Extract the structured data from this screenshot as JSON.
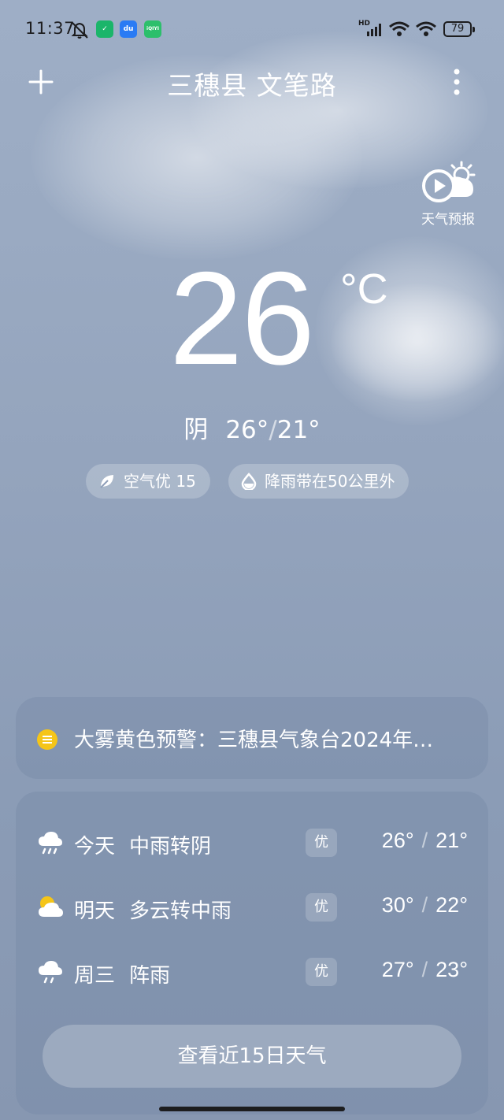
{
  "status_bar": {
    "time": "11:37",
    "network_label": "HD",
    "battery": "79",
    "apps": [
      "shield-app",
      "du",
      "iQIYI"
    ]
  },
  "header": {
    "location": "三穗县 文笔路"
  },
  "forecast_video": {
    "label": "天气预报"
  },
  "current": {
    "temperature": "26",
    "unit": "°C",
    "condition": "阴",
    "high": "26°",
    "low": "21°"
  },
  "pills": {
    "air": "空气优 15",
    "rain": "降雨带在50公里外"
  },
  "alert": {
    "text": "大雾黄色预警：三穗县气象台2024年…",
    "color": "#f5c518"
  },
  "forecast": [
    {
      "day": "今天",
      "condition": "中雨转阴",
      "aqi": "优",
      "high": "26°",
      "low": "21°",
      "icon": "rain-cloud-icon"
    },
    {
      "day": "明天",
      "condition": "多云转中雨",
      "aqi": "优",
      "high": "30°",
      "low": "22°",
      "icon": "partly-cloudy-icon"
    },
    {
      "day": "周三",
      "condition": "阵雨",
      "aqi": "优",
      "high": "27°",
      "low": "23°",
      "icon": "shower-icon"
    }
  ],
  "more_button": {
    "label": "查看近15日天气"
  }
}
